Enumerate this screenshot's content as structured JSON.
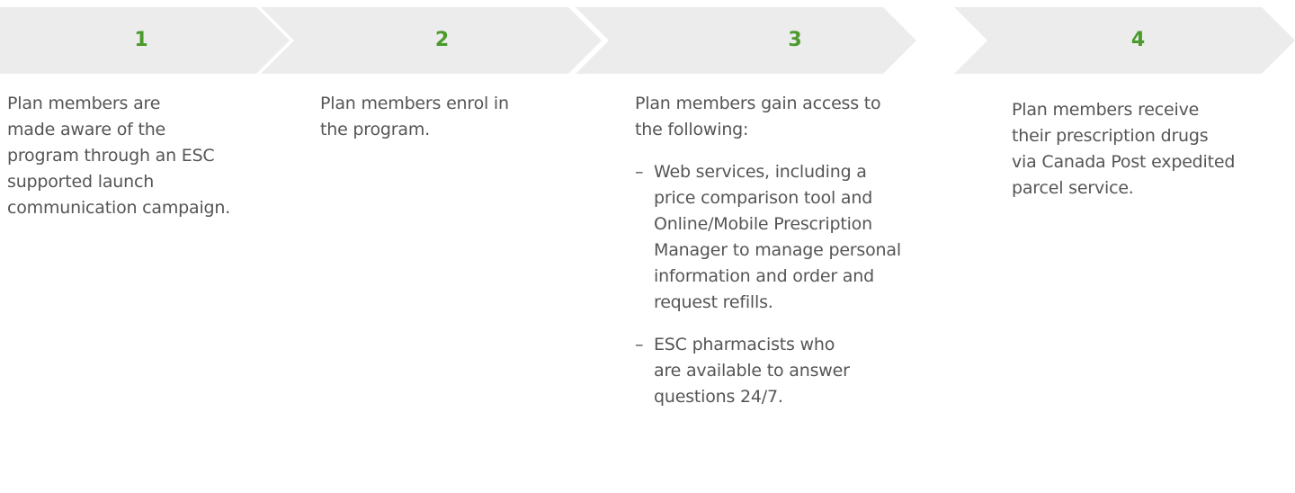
{
  "steps": [
    {
      "number": "1",
      "lines": [
        "Plan members are",
        "made aware of the",
        "program through an ESC",
        "supported launch",
        "communication campaign."
      ]
    },
    {
      "number": "2",
      "lines": [
        "Plan members enrol in",
        "the program."
      ]
    },
    {
      "number": "3",
      "lines": [
        "Plan members gain access to",
        "the following:"
      ],
      "bullet_marker": "–",
      "bullets": [
        {
          "lines": [
            "Web services, including a",
            "price comparison tool and",
            "Online/Mobile Prescription",
            "Manager to manage personal",
            "information and order and",
            "request refills."
          ]
        },
        {
          "lines": [
            "ESC pharmacists who",
            "are available to answer",
            "questions 24/7."
          ]
        }
      ]
    },
    {
      "number": "4",
      "lines": [
        "Plan members receive",
        "their prescription drugs",
        "via Canada Post expedited",
        "parcel service."
      ]
    }
  ],
  "colors": {
    "chevron_bg": "#ececec",
    "step_number": "#4a9a2c",
    "body_text": "#555555"
  }
}
